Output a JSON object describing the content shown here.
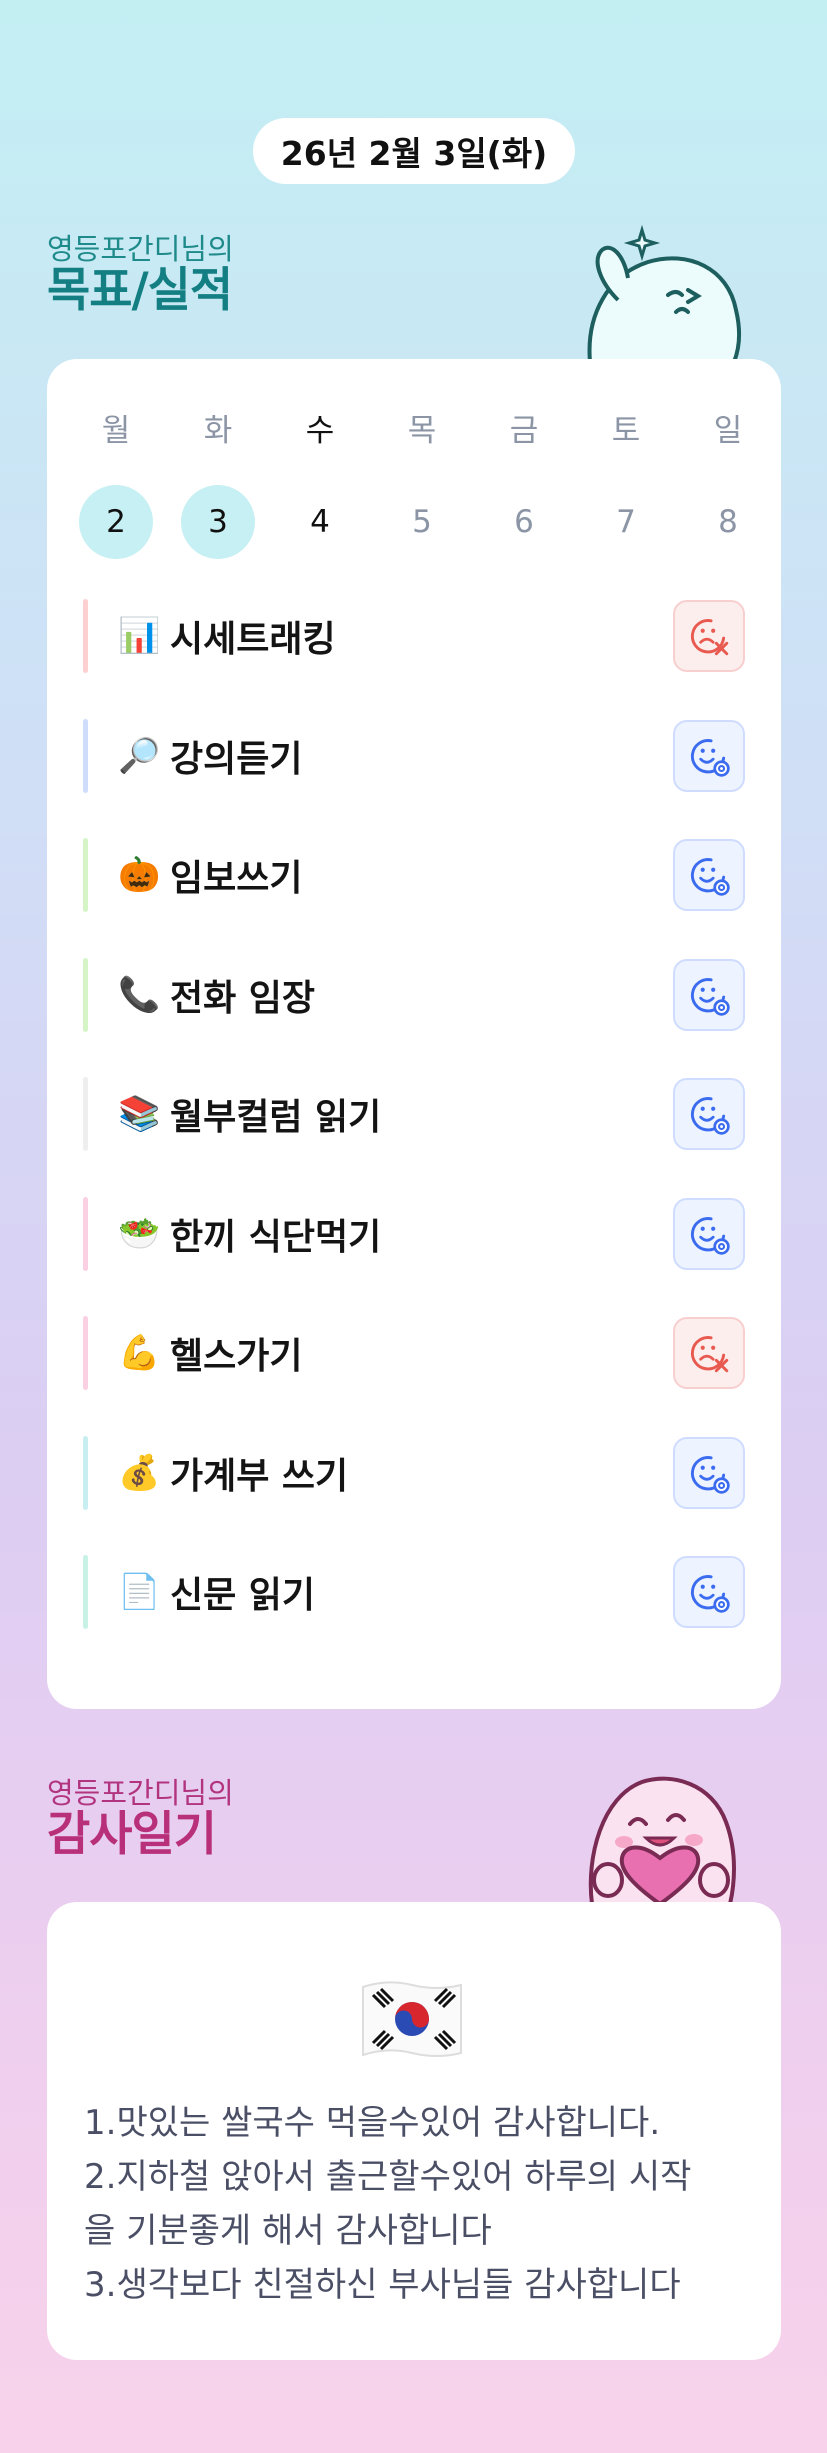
{
  "header": {
    "date": "26년 2월 3일(화)"
  },
  "goals_section": {
    "subtitle": "영등포간디님의",
    "title": "목표/실적"
  },
  "week": {
    "days": [
      "월",
      "화",
      "수",
      "목",
      "금",
      "토",
      "일"
    ],
    "dates": [
      "2",
      "3",
      "4",
      "5",
      "6",
      "7",
      "8"
    ],
    "completed_indices": [
      0,
      1
    ],
    "current_index": 2
  },
  "goals": [
    {
      "emoji": "📊",
      "label": "시세트래킹",
      "status": "fail",
      "bar_color": "#fcd0d0"
    },
    {
      "emoji": "🔎",
      "label": "강의듣기",
      "status": "success",
      "bar_color": "#d0dcfb"
    },
    {
      "emoji": "🎃",
      "label": "임보쓰기",
      "status": "success",
      "bar_color": "#d6f5c6"
    },
    {
      "emoji": "📞",
      "label": "전화 임장",
      "status": "success",
      "bar_color": "#d6f5c6"
    },
    {
      "emoji": "📚",
      "label": "월부컬럼 읽기",
      "status": "success",
      "bar_color": "#eeeeee"
    },
    {
      "emoji": "🥗",
      "label": "한끼 식단먹기",
      "status": "success",
      "bar_color": "#fad0e2"
    },
    {
      "emoji": "💪",
      "label": "헬스가기",
      "status": "fail",
      "bar_color": "#fad0e2"
    },
    {
      "emoji": "💰",
      "label": "가계부 쓰기",
      "status": "success",
      "bar_color": "#c9eef2"
    },
    {
      "emoji": "📄",
      "label": "신문 읽기",
      "status": "success",
      "bar_color": "#c9f2e6"
    }
  ],
  "gratitude_section": {
    "subtitle": "영등포간디님의",
    "title": "감사일기"
  },
  "gratitude": {
    "lines": [
      "1.맛있는 쌀국수 먹을수있어 감사합니다.",
      "2.지하철 앉아서 출근할수있어 하루의 시작",
      "을 기분좋게 해서 감사합니다",
      "3.생각보다 친절하신 부사님들 감사합니다"
    ]
  },
  "colors": {
    "success_icon": "#3b6cf0",
    "fail_icon": "#e85a4f",
    "accent_teal": "#147f82",
    "accent_pink": "#b8307a"
  }
}
